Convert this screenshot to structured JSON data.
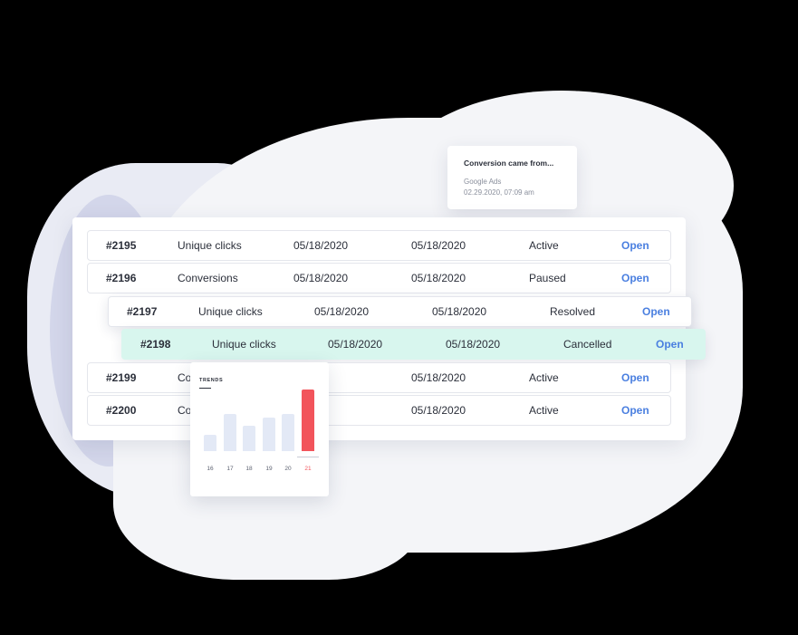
{
  "notification": {
    "title": "Conversion came from...",
    "source": "Google Ads",
    "timestamp": "02.29.2020, 07:09 am"
  },
  "table": {
    "rows": [
      {
        "id": "#2195",
        "metric": "Unique clicks",
        "date1": "05/18/2020",
        "date2": "05/18/2020",
        "status": "Active",
        "action": "Open"
      },
      {
        "id": "#2196",
        "metric": "Conversions",
        "date1": "05/18/2020",
        "date2": "05/18/2020",
        "status": "Paused",
        "action": "Open"
      },
      {
        "id": "#2197",
        "metric": "Unique clicks",
        "date1": "05/18/2020",
        "date2": "05/18/2020",
        "status": "Resolved",
        "action": "Open"
      },
      {
        "id": "#2198",
        "metric": "Unique clicks",
        "date1": "05/18/2020",
        "date2": "05/18/2020",
        "status": "Cancelled",
        "action": "Open"
      },
      {
        "id": "#2199",
        "metric": "Co",
        "date1": "20",
        "date2": "05/18/2020",
        "status": "Active",
        "action": "Open"
      },
      {
        "id": "#2200",
        "metric": "Co",
        "date1": "20",
        "date2": "05/18/2020",
        "status": "Active",
        "action": "Open"
      }
    ]
  },
  "trends": {
    "title": "TRENDS",
    "bars": [
      {
        "label": "16",
        "value": 18
      },
      {
        "label": "17",
        "value": 41
      },
      {
        "label": "18",
        "value": 28
      },
      {
        "label": "19",
        "value": 37
      },
      {
        "label": "20",
        "value": 41
      },
      {
        "label": "21",
        "value": 68,
        "active": true
      }
    ]
  },
  "colors": {
    "accent_link": "#4a7fe0",
    "highlight_row": "#d8f6ee",
    "trend_active": "#f2545b",
    "trend_bar": "#e3e9f6"
  }
}
